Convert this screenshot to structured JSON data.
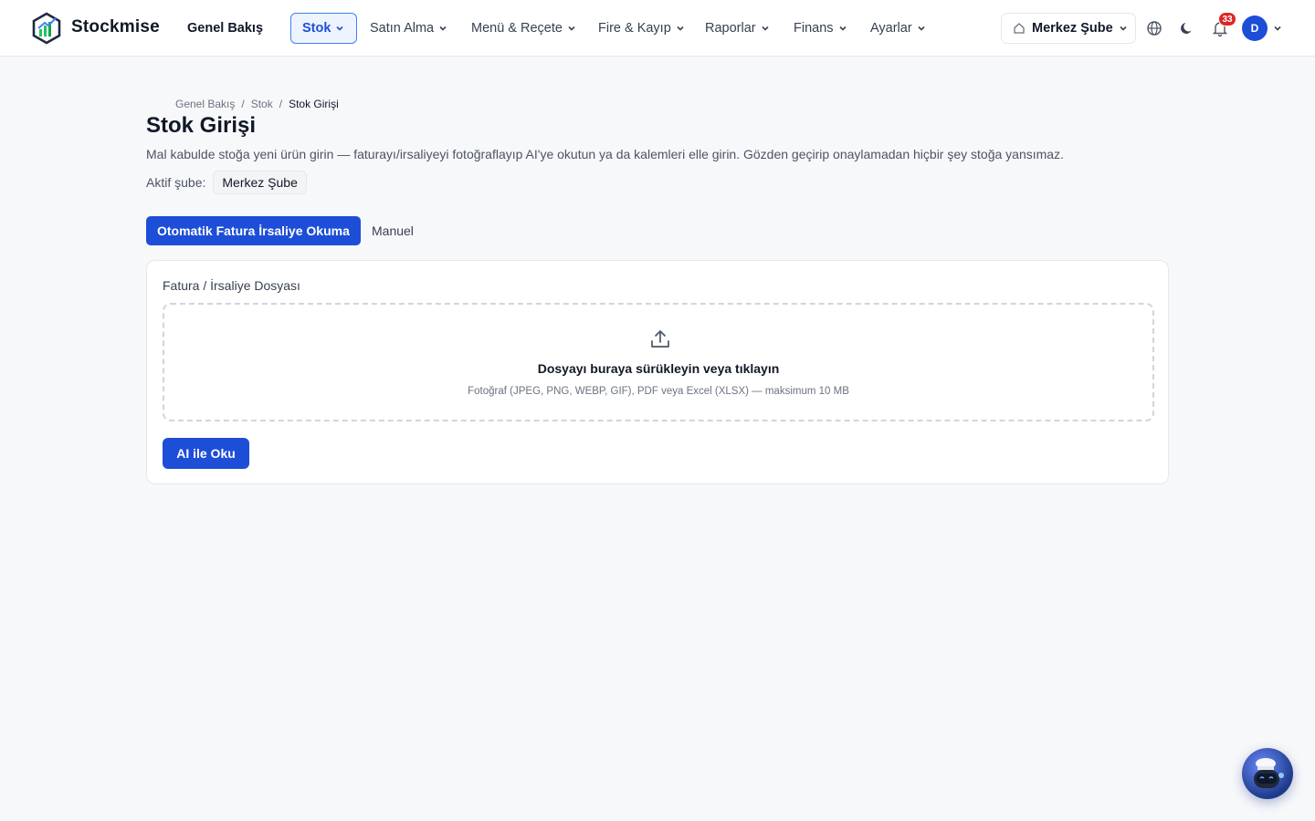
{
  "app": {
    "brand": "Stockmise"
  },
  "nav": {
    "home": "Genel Bakış",
    "items": [
      {
        "label": "Stok"
      },
      {
        "label": "Satın Alma"
      },
      {
        "label": "Menü & Reçete"
      },
      {
        "label": "Fire & Kayıp"
      },
      {
        "label": "Raporlar"
      },
      {
        "label": "Finans"
      },
      {
        "label": "Ayarlar"
      }
    ],
    "branch": "Merkez Şube",
    "notifications": "33",
    "avatar": "D"
  },
  "breadcrumb": [
    "Genel Bakış",
    "Stok",
    "Stok Girişi"
  ],
  "page": {
    "title": "Stok Girişi",
    "description": "Mal kabulde stoğa yeni ürün girin — faturayı/irsaliyeyi fotoğraflayıp AI'ye okutun ya da kalemleri elle girin. Gözden geçirip onaylamadan hiçbir şey stoğa yansımaz.",
    "active_branch_label": "Aktif şube:",
    "active_branch": "Merkez Şube"
  },
  "tabs": {
    "auto": "Otomatik Fatura İrsaliye Okuma",
    "manual": "Manuel"
  },
  "upload": {
    "label": "Fatura / İrsaliye Dosyası",
    "title": "Dosyayı buraya sürükleyin veya tıklayın",
    "hint": "Fotoğraf (JPEG, PNG, WEBP, GIF), PDF veya Excel (XLSX) — maksimum 10 MB",
    "button": "AI ile Oku"
  },
  "colors": {
    "primary": "#1d4ed8",
    "badge": "#dc2626",
    "background": "#f7f8fa"
  }
}
